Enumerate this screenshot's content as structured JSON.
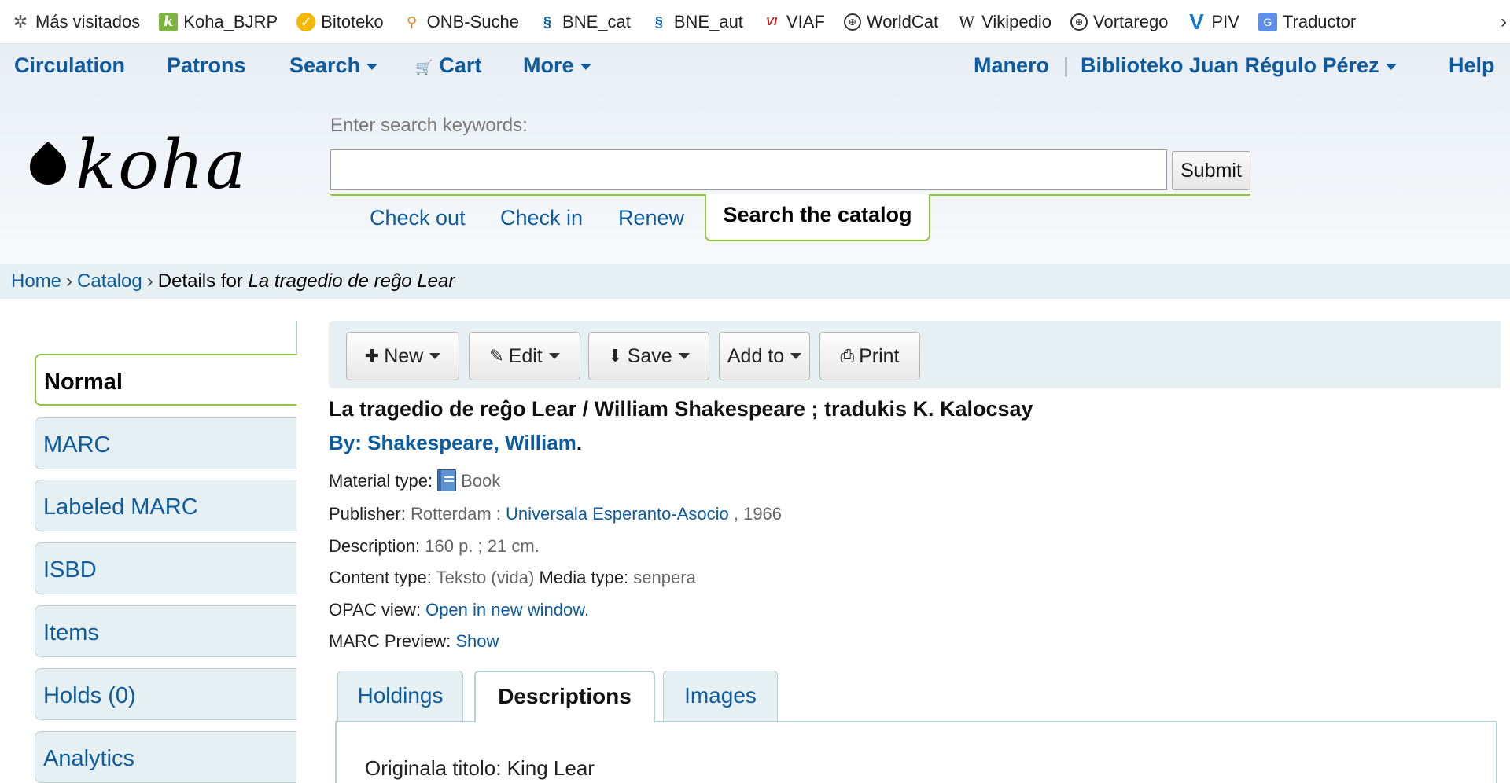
{
  "bookmarks": [
    {
      "label": "Más visitados",
      "icon": "gear-star-icon"
    },
    {
      "label": "Koha_BJRP",
      "icon": "koha-k-icon"
    },
    {
      "label": "Bitoteko",
      "icon": "bitoteko-icon"
    },
    {
      "label": "ONB-Suche",
      "icon": "onb-icon"
    },
    {
      "label": "BNE_cat",
      "icon": "bne-icon"
    },
    {
      "label": "BNE_aut",
      "icon": "bne-icon"
    },
    {
      "label": "VIAF",
      "icon": "viaf-icon"
    },
    {
      "label": "WorldCat",
      "icon": "globe-icon"
    },
    {
      "label": "Vikipedio",
      "icon": "wikipedia-icon"
    },
    {
      "label": "Vortarego",
      "icon": "globe-icon"
    },
    {
      "label": "PIV",
      "icon": "piv-icon"
    },
    {
      "label": "Traductor",
      "icon": "translate-icon"
    }
  ],
  "topnav": {
    "circulation": "Circulation",
    "patrons": "Patrons",
    "search": "Search",
    "cart": "Cart",
    "more": "More",
    "user": "Manero",
    "separator": "|",
    "library": "Biblioteko Juan Régulo Pérez",
    "help": "Help"
  },
  "logo": {
    "text": "koha"
  },
  "search": {
    "label": "Enter search keywords:",
    "value": "",
    "submit": "Submit",
    "tabs": [
      "Check out",
      "Check in",
      "Renew"
    ],
    "active_tab": "Search the catalog"
  },
  "breadcrumb": {
    "home": "Home",
    "catalog": "Catalog",
    "details_prefix": "Details for",
    "details_title": "La tragedio de reĝo Lear",
    "sep": "›"
  },
  "sidebar": {
    "items": [
      "Normal",
      "MARC",
      "Labeled MARC",
      "ISBD",
      "Items",
      "Holds (0)",
      "Analytics"
    ],
    "active": "Normal"
  },
  "toolbar": {
    "new": "New",
    "edit": "Edit",
    "save": "Save",
    "add_to": "Add to",
    "print": "Print"
  },
  "record": {
    "title": "La tragedio de reĝo Lear / William Shakespeare ; tradukis K. Kalocsay",
    "by_label": "By:",
    "author": "Shakespeare, William",
    "author_end": ".",
    "material_label": "Material type:",
    "material_value": "Book",
    "publisher_label": "Publisher:",
    "publisher_place": "Rotterdam :",
    "publisher_name": "Universala Esperanto-Asocio",
    "publisher_year": ", 1966",
    "description_label": "Description:",
    "description_value": "160 p. ; 21 cm.",
    "content_type_label": "Content type:",
    "content_type_value": "Teksto (vida)",
    "media_type_label": "Media type:",
    "media_type_value": "senpera",
    "opac_label": "OPAC view:",
    "opac_link": "Open in new window.",
    "marc_preview_label": "MARC Preview:",
    "marc_preview_link": "Show"
  },
  "detail_tabs": {
    "tabs": [
      "Holdings",
      "Descriptions",
      "Images"
    ],
    "active": "Descriptions",
    "content": "Originala titolo: King Lear"
  }
}
